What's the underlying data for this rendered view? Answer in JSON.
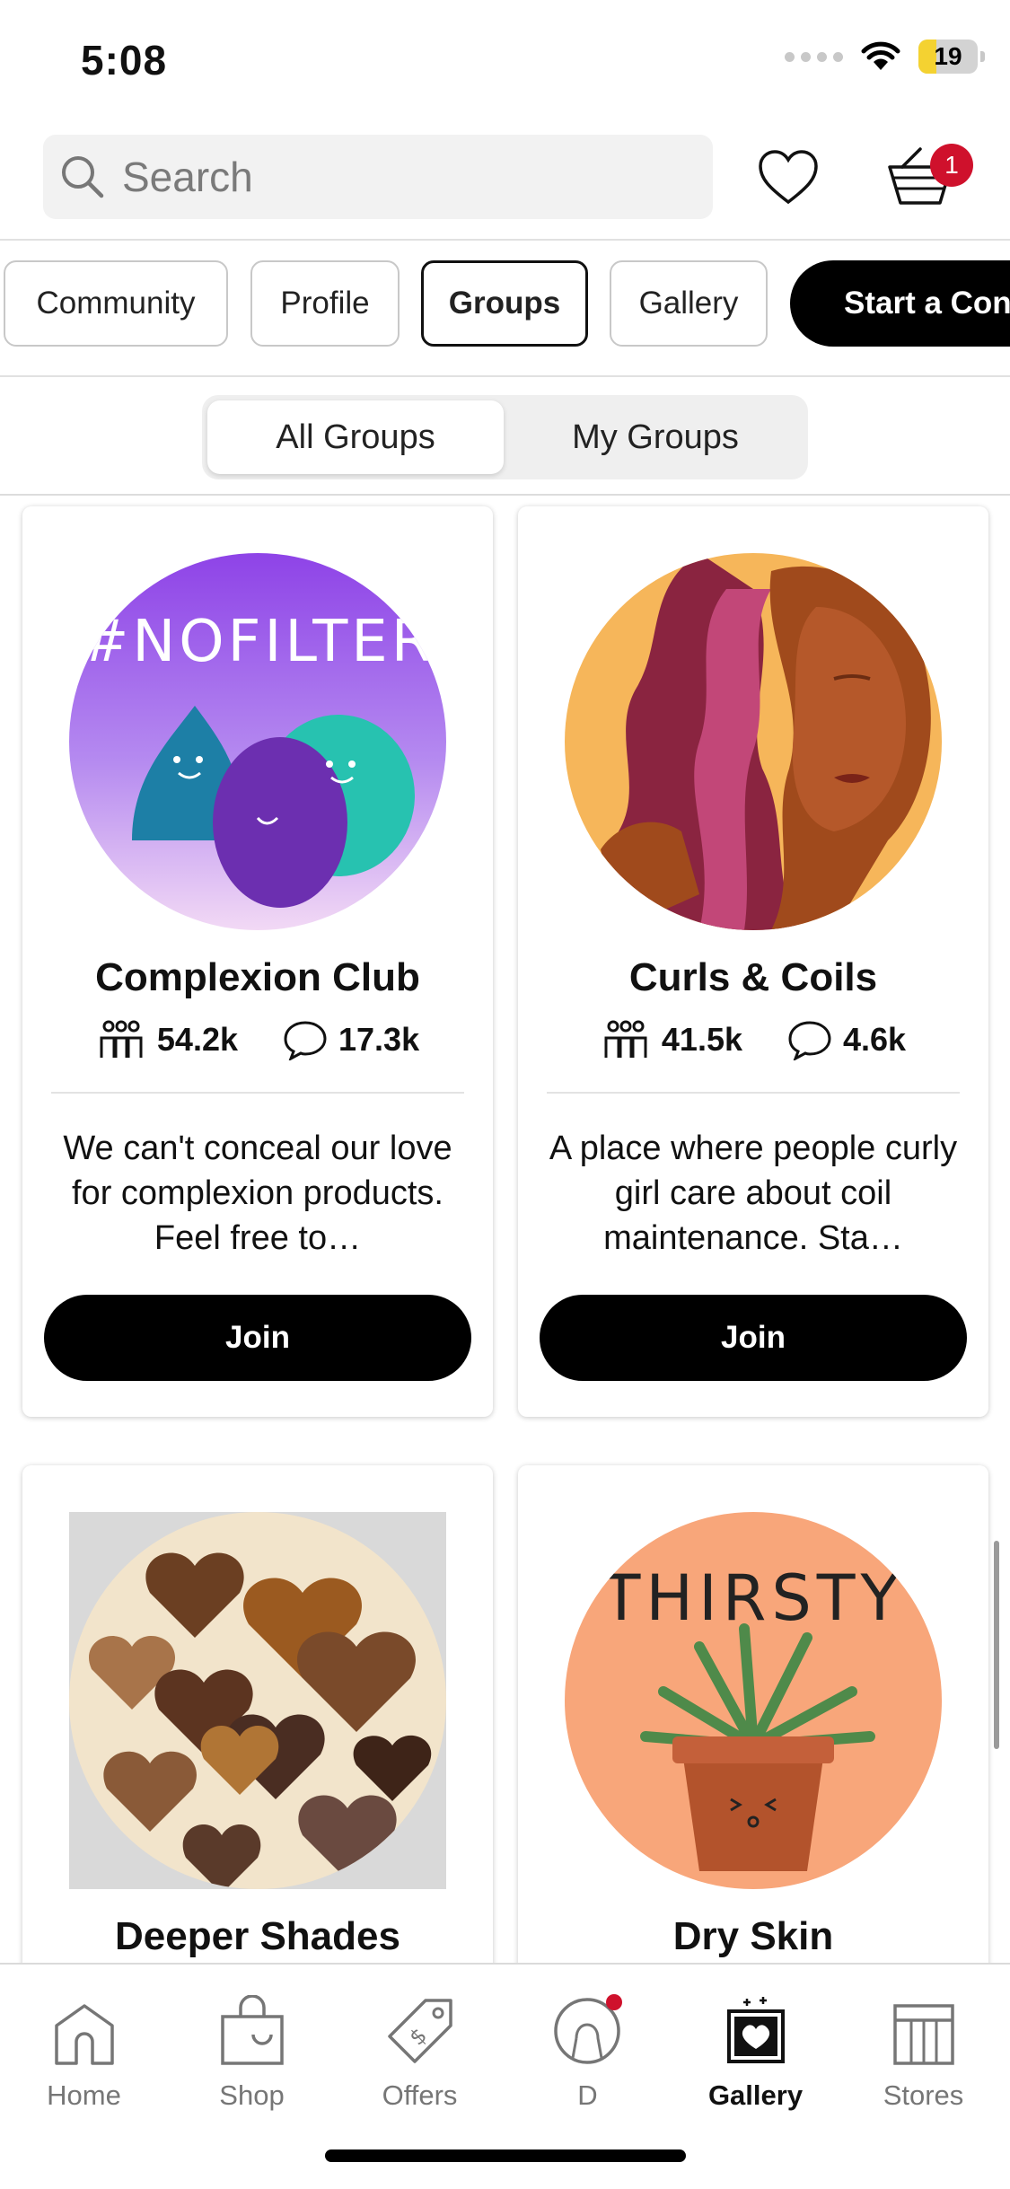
{
  "status_bar": {
    "time": "5:08",
    "battery": "19"
  },
  "search": {
    "placeholder": "Search"
  },
  "cart": {
    "badge_count": "1"
  },
  "nav_chips": [
    {
      "label": "Community"
    },
    {
      "label": "Profile"
    },
    {
      "label": "Groups",
      "active": true
    },
    {
      "label": "Gallery"
    },
    {
      "label": "Start a Conversation",
      "style": "cta"
    }
  ],
  "segments": {
    "all": "All Groups",
    "mine": "My Groups",
    "selected": "All Groups"
  },
  "groups": [
    {
      "name": "Complexion Club",
      "members": "54.2k",
      "posts": "17.3k",
      "description": "We can't conceal our love for complexion products. Feel free to…",
      "button": "Join"
    },
    {
      "name": "Curls & Coils",
      "members": "41.5k",
      "posts": "4.6k",
      "description": "A place where people curly girl care about coil maintenance. Sta…",
      "button": "Join"
    },
    {
      "name": "Deeper Shades"
    },
    {
      "name": "Dry Skin"
    }
  ],
  "artwork_text": {
    "nofilter": "#NOFILTER",
    "thirsty": "THIRSTY"
  },
  "tabs": [
    {
      "label": "Home",
      "icon": "home-icon"
    },
    {
      "label": "Shop",
      "icon": "shopping-bag-icon"
    },
    {
      "label": "Offers",
      "icon": "tag-icon"
    },
    {
      "label": "D",
      "icon": "profile-icon"
    },
    {
      "label": "Gallery",
      "icon": "gallery-icon",
      "active": true
    },
    {
      "label": "Stores",
      "icon": "store-icon"
    }
  ],
  "colors": {
    "badge_red": "#cf112c",
    "battery_yellow": "#f4d231",
    "button_black": "#000000"
  }
}
